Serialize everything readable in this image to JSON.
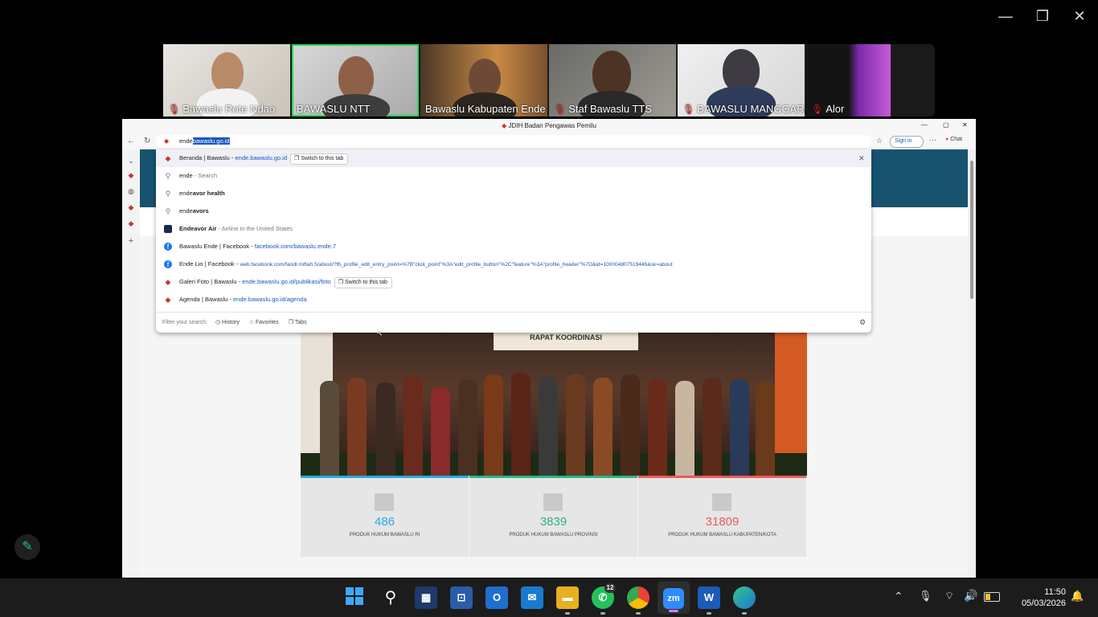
{
  "zoom_window": {
    "minimize": "—",
    "restore": "❐",
    "close": "✕"
  },
  "participants": [
    {
      "name": "Bawaslu Rote Ndao",
      "muted": true
    },
    {
      "name": "BAWASLU NTT",
      "muted": false
    },
    {
      "name": "Bawaslu Kabupaten Ende",
      "muted": false
    },
    {
      "name": "Staf Bawaslu TTS",
      "muted": true
    },
    {
      "name": "BAWASLU MANGGARAI",
      "muted": true
    },
    {
      "name": "Alor",
      "muted": true
    }
  ],
  "browser": {
    "title": "JDIH Badan Pengawas Pemilu",
    "omnibox": {
      "typed": "ende",
      "completion": "bawaslu.go.id"
    },
    "signin": "Sign in",
    "chat": "Chat",
    "suggestions": [
      {
        "kind": "tab",
        "title": "Beranda | Bawaslu",
        "sep": " - ",
        "url": "ende.bawaslu.go.id",
        "button": "Switch to this tab"
      },
      {
        "kind": "search",
        "bold": "ende",
        "rest": " - Search"
      },
      {
        "kind": "search",
        "bold": "ende",
        "rest": "avor health"
      },
      {
        "kind": "search",
        "bold": "ende",
        "rest": "avors"
      },
      {
        "kind": "entity",
        "title": "Endeavor Air",
        "rest": " - Airline in the United States"
      },
      {
        "kind": "fb",
        "title": "Bawaslu Ende | Facebook",
        "sep": " - ",
        "url": "facebook.com/bawaslu.ende.7"
      },
      {
        "kind": "fb",
        "title": "Ende Lio | Facebook",
        "sep": " - ",
        "url": "web.facebook.com/faridl.miftah.5/about/?fb_profile_edit_entry_point=%7B\"click_point\"%3A\"edit_profile_button\"%2C\"feature\"%3A\"profile_header\"%7D&id=100004807519445&sk=about"
      },
      {
        "kind": "tab",
        "title": "Galeri Foto | Bawaslu",
        "sep": " - ",
        "url": "ende.bawaslu.go.id/publikasi/foto",
        "button": "Switch to this tab"
      },
      {
        "kind": "site",
        "title": "Agenda | Bawaslu",
        "sep": " - ",
        "url": "ende.bawaslu.go.id/agenda"
      }
    ],
    "filter": {
      "label": "Filter your search:",
      "history": "History",
      "favorites": "Favorites",
      "tabs": "Tabs"
    }
  },
  "banner_text": "RAPAT KOORDINASI",
  "stats": [
    {
      "value": "486",
      "label": "PRODUK HUKUM BAWASLU RI",
      "color": "#29a8e0"
    },
    {
      "value": "3839",
      "label": "PRODUK HUKUM BAWASLU PROVINSI",
      "color": "#2bb585"
    },
    {
      "value": "31809",
      "label": "PRODUK HUKUM BAWASLU KABUPATEN/KOTA",
      "color": "#ec5a5a"
    }
  ],
  "taskbar": {
    "whatsapp_badge": "12",
    "time": "11:50",
    "date": "05/03/2026"
  }
}
